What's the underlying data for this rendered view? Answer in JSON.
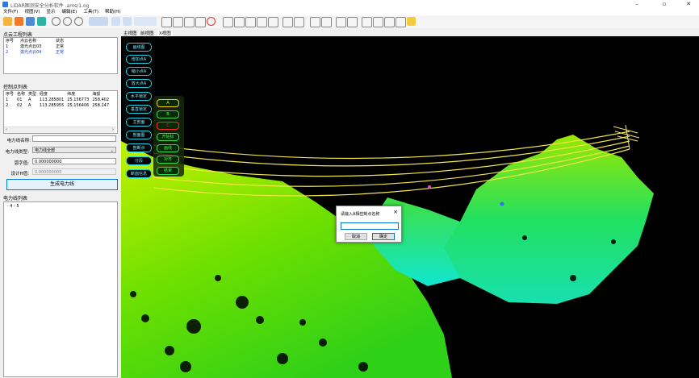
{
  "window": {
    "title": "LiDAR图测安全分析软件 .ams/1.og"
  },
  "menu": [
    "文件(F)",
    "视图(V)",
    "显示",
    "编辑(E)",
    "工具(T)",
    "帮助(H)"
  ],
  "point_cloud_projects": {
    "title": "点云工程列表",
    "headers": [
      "序号",
      "点云名称",
      "状态"
    ],
    "rows": [
      [
        "1",
        "激光点云03",
        "正常"
      ],
      [
        "2",
        "激光点云04",
        "正常"
      ]
    ]
  },
  "control_points": {
    "title": "控制点列表",
    "headers": [
      "序号",
      "名称",
      "类型",
      "经度",
      "纬度",
      "海拔"
    ],
    "rows": [
      [
        "1",
        "01",
        "A",
        "113.285801",
        "25.156773",
        "258.402"
      ],
      [
        "2",
        "02",
        "A",
        "113.285955",
        "25.156406",
        "258.247"
      ]
    ]
  },
  "powerline_form": {
    "name_label": "电力线名称:",
    "name_value": "",
    "type_label": "电力线类型:",
    "type_value": "电力线全部",
    "sag_label": "弧字值:",
    "sag_value": "0.000000000",
    "design_label": "设计H值:",
    "design_value": "0.000000000",
    "generate_button": "生成电力线"
  },
  "powerline_list": {
    "title": "电力线列表",
    "items": [
      "4 - 5"
    ]
  },
  "view_tabs": [
    "主视图",
    "前视图",
    "X视图"
  ],
  "viewport_buttons": [
    "画线图",
    "增加点A",
    "缩小点A",
    "放大点A",
    "水平锁定",
    "垂直锁定",
    "主剖面",
    "剖面图",
    "剖断点",
    "分段",
    "断面信息"
  ],
  "marker_buttons": [
    {
      "label": "A",
      "color": "#ffd000"
    },
    {
      "label": "B",
      "color": "#3cff3c"
    },
    {
      "label": "C",
      "color": "#ff2a2a"
    },
    {
      "label": "开始标",
      "color": "#3cff3c"
    },
    {
      "label": "画线",
      "color": "#3cff3c"
    },
    {
      "label": "对齐",
      "color": "#3cff3c"
    },
    {
      "label": "结束",
      "color": "#3cff3c"
    }
  ],
  "dialog": {
    "title": "请输入A相控制点名称",
    "value": "",
    "cancel": "取消",
    "ok": "确定"
  },
  "colors": {
    "accent": "#0078d7",
    "viewport_bg": "#000000",
    "button_border": "#19d3e8"
  }
}
